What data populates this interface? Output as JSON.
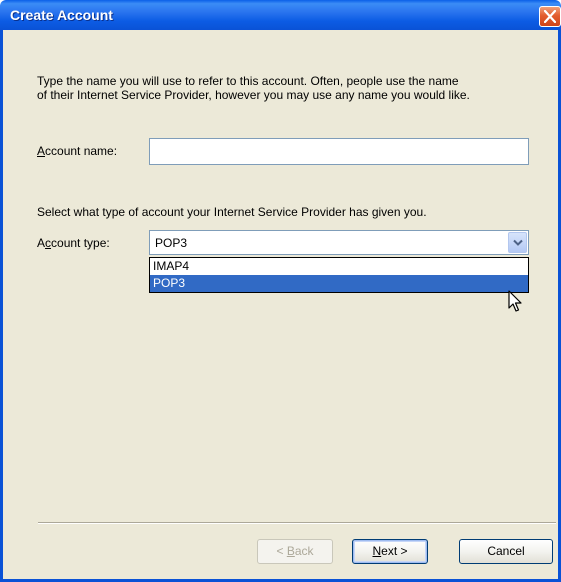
{
  "window": {
    "title": "Create Account",
    "close_label": "Close"
  },
  "intro": {
    "line1": "Type the name you will use to refer to this account.  Often, people use the name",
    "line2": "of their Internet Service Provider, however you may use any name you would like."
  },
  "account_name": {
    "label_mnemonic": "A",
    "label_rest": "ccount name:",
    "value": ""
  },
  "account_type": {
    "prompt": "Select what type of account your Internet Service Provider has given you.",
    "label_pre": "A",
    "label_mnemonic": "c",
    "label_rest": "count type:",
    "selected": "POP3",
    "options": [
      "IMAP4",
      "POP3"
    ]
  },
  "buttons": {
    "back_prefix": "< ",
    "back_mnemonic": "B",
    "back_rest": "ack",
    "next_mnemonic": "N",
    "next_rest": "ext >",
    "cancel": "Cancel"
  },
  "colors": {
    "titlebar": "#0a5fe8",
    "dialog_bg": "#ece9d8",
    "selection": "#316ac5",
    "close": "#e35c2e"
  },
  "icons": {
    "close": "close-icon",
    "dropdown": "chevron-down-icon",
    "cursor": "mouse-pointer-icon"
  }
}
